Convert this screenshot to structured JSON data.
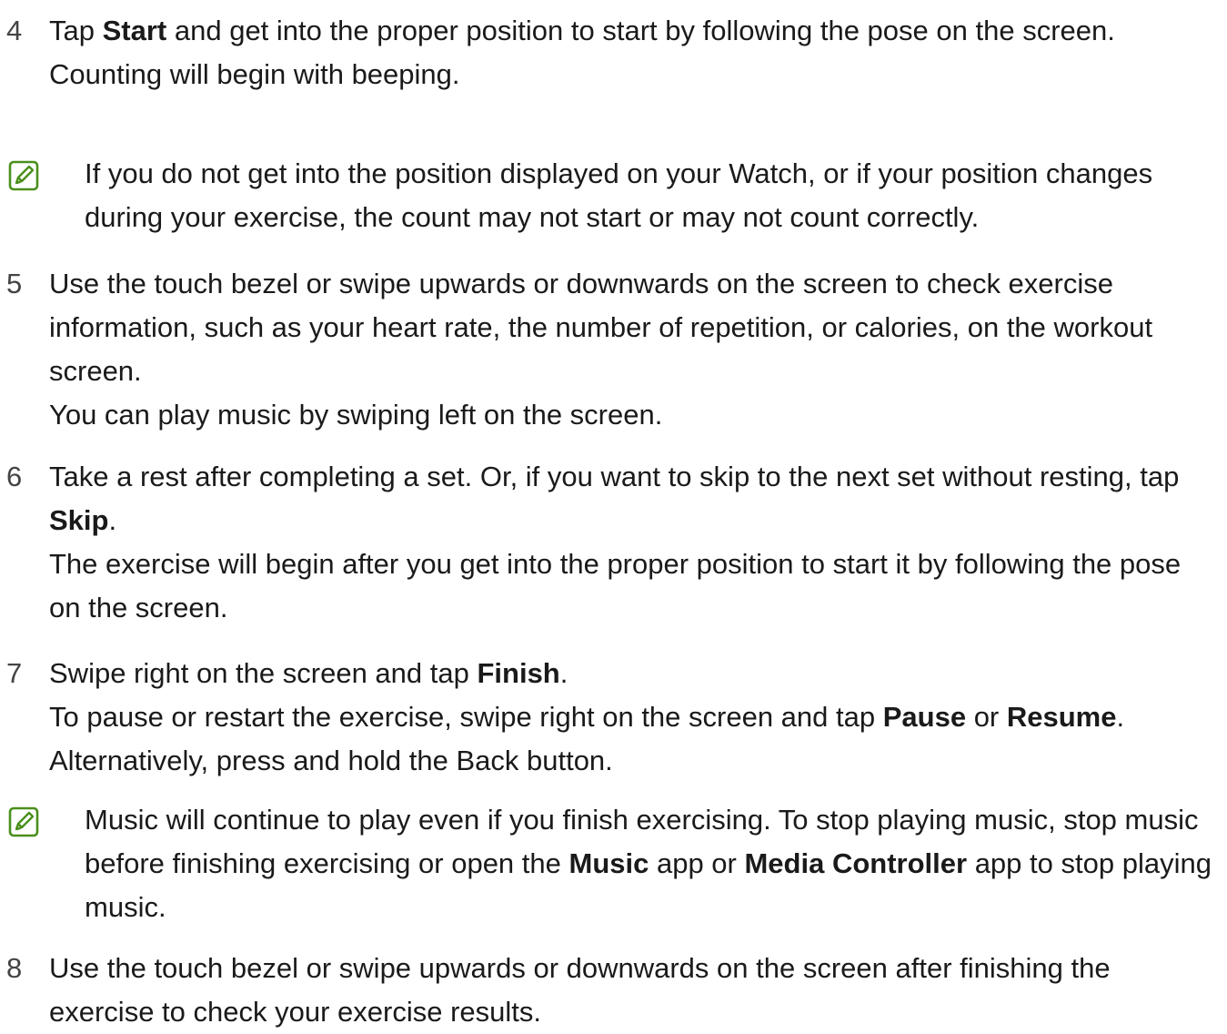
{
  "steps": [
    {
      "number": "4",
      "paragraphs": [
        [
          {
            "text": "Tap "
          },
          {
            "text": "Start",
            "bold": true
          },
          {
            "text": " and get into the proper position to start by following the pose on the screen."
          }
        ],
        [
          {
            "text": "Counting will begin with beeping."
          }
        ]
      ]
    },
    {
      "number": "5",
      "paragraphs": [
        [
          {
            "text": "Use the touch bezel or swipe upwards or downwards on the screen to check exercise information, such as your heart rate, the number of repetition, or calories, on the workout screen."
          }
        ],
        [
          {
            "text": "You can play music by swiping left on the screen."
          }
        ]
      ]
    },
    {
      "number": "6",
      "paragraphs": [
        [
          {
            "text": "Take a rest after completing a set. Or, if you want to skip to the next set without resting, tap "
          },
          {
            "text": "Skip",
            "bold": true
          },
          {
            "text": "."
          }
        ],
        [
          {
            "text": "The exercise will begin after you get into the proper position to start it by following the pose on the screen."
          }
        ]
      ]
    },
    {
      "number": "7",
      "paragraphs": [
        [
          {
            "text": "Swipe right on the screen and tap "
          },
          {
            "text": "Finish",
            "bold": true
          },
          {
            "text": "."
          }
        ],
        [
          {
            "text": "To pause or restart the exercise, swipe right on the screen and tap "
          },
          {
            "text": "Pause",
            "bold": true
          },
          {
            "text": " or "
          },
          {
            "text": "Resume",
            "bold": true
          },
          {
            "text": ". Alternatively, press and hold the Back button."
          }
        ]
      ]
    },
    {
      "number": "8",
      "paragraphs": [
        [
          {
            "text": "Use the touch bezel or swipe upwards or downwards on the screen after finishing the exercise to check your exercise results."
          }
        ]
      ]
    }
  ],
  "notes": [
    {
      "icon": "note-pencil-icon",
      "segments": [
        {
          "text": "If you do not get into the position displayed on your Watch, or if your position changes during your exercise, the count may not start or may not count correctly."
        }
      ]
    },
    {
      "icon": "note-pencil-icon",
      "segments": [
        {
          "text": "Music will continue to play even if you finish exercising. To stop playing music, stop music before finishing exercising or open the "
        },
        {
          "text": "Music",
          "bold": true
        },
        {
          "text": " app or "
        },
        {
          "text": "Media Controller",
          "bold": true
        },
        {
          "text": " app to stop playing music."
        }
      ]
    }
  ],
  "colors": {
    "note_icon": "#4a8f1c",
    "text": "#1a1a1a"
  }
}
